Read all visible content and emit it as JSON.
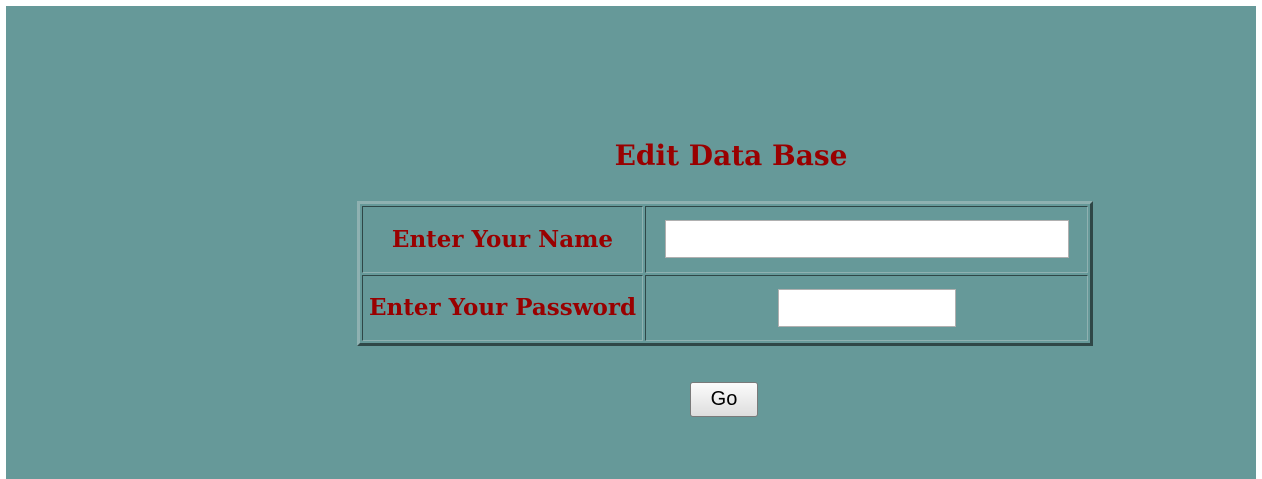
{
  "heading": "Edit Data Base",
  "form": {
    "name_label": "Enter Your Name",
    "name_value": "",
    "password_label": "Enter Your Password",
    "password_value": ""
  },
  "submit_label": "Go"
}
